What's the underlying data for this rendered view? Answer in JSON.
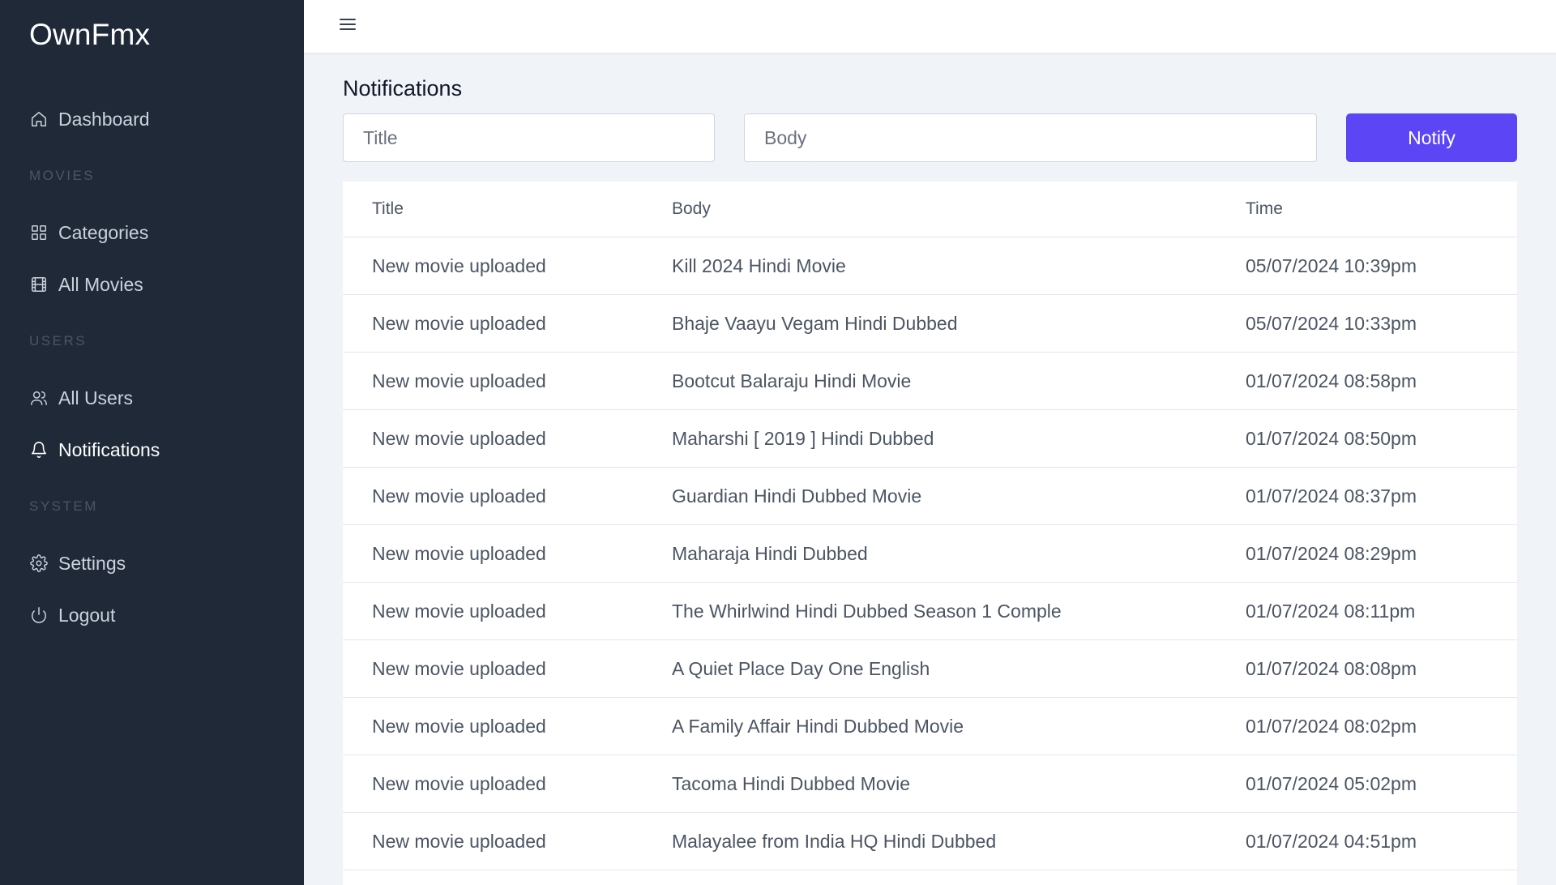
{
  "sidebar": {
    "brand": "OwnFmx",
    "dashboard_label": "Dashboard",
    "sections": {
      "movies": "MOVIES",
      "users": "USERS",
      "system": "SYSTEM"
    },
    "categories_label": "Categories",
    "all_movies_label": "All Movies",
    "all_users_label": "All Users",
    "notifications_label": "Notifications",
    "settings_label": "Settings",
    "logout_label": "Logout",
    "active_item": "Notifications"
  },
  "topbar": {
    "menu_icon": "hamburger-menu-icon"
  },
  "page": {
    "title": "Notifications"
  },
  "form": {
    "title_placeholder": "Title",
    "body_placeholder": "Body",
    "notify_label": "Notify"
  },
  "table": {
    "headers": {
      "title": "Title",
      "body": "Body",
      "time": "Time"
    },
    "rows": [
      {
        "title": "New movie uploaded",
        "body": "Kill 2024 Hindi Movie",
        "time": "05/07/2024 10:39pm"
      },
      {
        "title": "New movie uploaded",
        "body": "Bhaje Vaayu Vegam Hindi Dubbed",
        "time": "05/07/2024 10:33pm"
      },
      {
        "title": "New movie uploaded",
        "body": "Bootcut Balaraju Hindi Movie",
        "time": "01/07/2024 08:58pm"
      },
      {
        "title": "New movie uploaded",
        "body": "Maharshi [ 2019 ] Hindi Dubbed",
        "time": "01/07/2024 08:50pm"
      },
      {
        "title": "New movie uploaded",
        "body": "Guardian Hindi Dubbed Movie",
        "time": "01/07/2024 08:37pm"
      },
      {
        "title": "New movie uploaded",
        "body": "Maharaja Hindi Dubbed",
        "time": "01/07/2024 08:29pm"
      },
      {
        "title": "New movie uploaded",
        "body": "The Whirlwind Hindi Dubbed Season 1 Comple",
        "time": "01/07/2024 08:11pm"
      },
      {
        "title": "New movie uploaded",
        "body": "A Quiet Place Day One English",
        "time": "01/07/2024 08:08pm"
      },
      {
        "title": "New movie uploaded",
        "body": "A Family Affair Hindi Dubbed Movie",
        "time": "01/07/2024 08:02pm"
      },
      {
        "title": "New movie uploaded",
        "body": "Tacoma Hindi Dubbed Movie",
        "time": "01/07/2024 05:02pm"
      },
      {
        "title": "New movie uploaded",
        "body": "Malayalee from India HQ Hindi Dubbed",
        "time": "01/07/2024 04:51pm"
      }
    ]
  },
  "colors": {
    "sidebar_bg": "#1f2937",
    "accent": "#5b45f5",
    "page_bg": "#f0f3f8"
  }
}
